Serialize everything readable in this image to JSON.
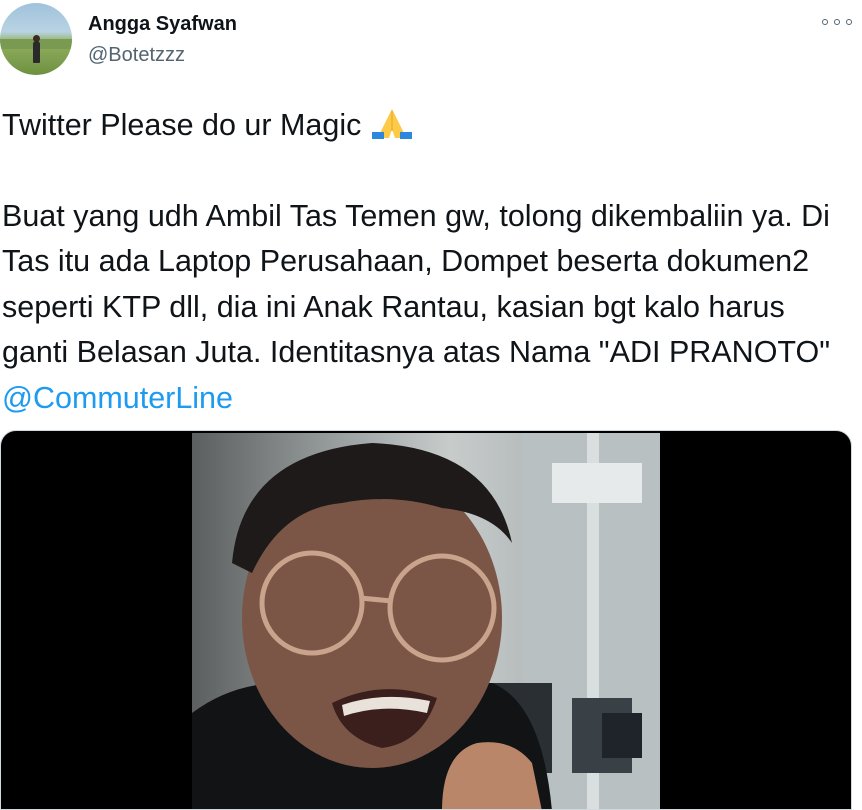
{
  "author": {
    "name": "Angga Syafwan",
    "handle": "@Botetzzz",
    "avatar_icon": "avatar-photo-person-in-field"
  },
  "more_icon": "more-options-icon",
  "tweet": {
    "line1": "Twitter Please do ur Magic",
    "emoji": "folded-hands-emoji",
    "body": "Buat yang udh Ambil Tas Temen gw, tolong dikembaliin ya. Di Tas itu ada Laptop Perusahaan, Dompet beserta dokumen2 seperti KTP dll, dia ini Anak Rantau, kasian bgt kalo harus ganti Belasan Juta. Identitasnya atas Nama \"ADI PRANOTO\"",
    "mention": "@CommuterLine"
  },
  "media": {
    "description_icon": "video-thumbnail-crying-man-in-train"
  },
  "colors": {
    "text": "#0f1419",
    "secondary": "#536471",
    "link": "#1d9bf0"
  }
}
